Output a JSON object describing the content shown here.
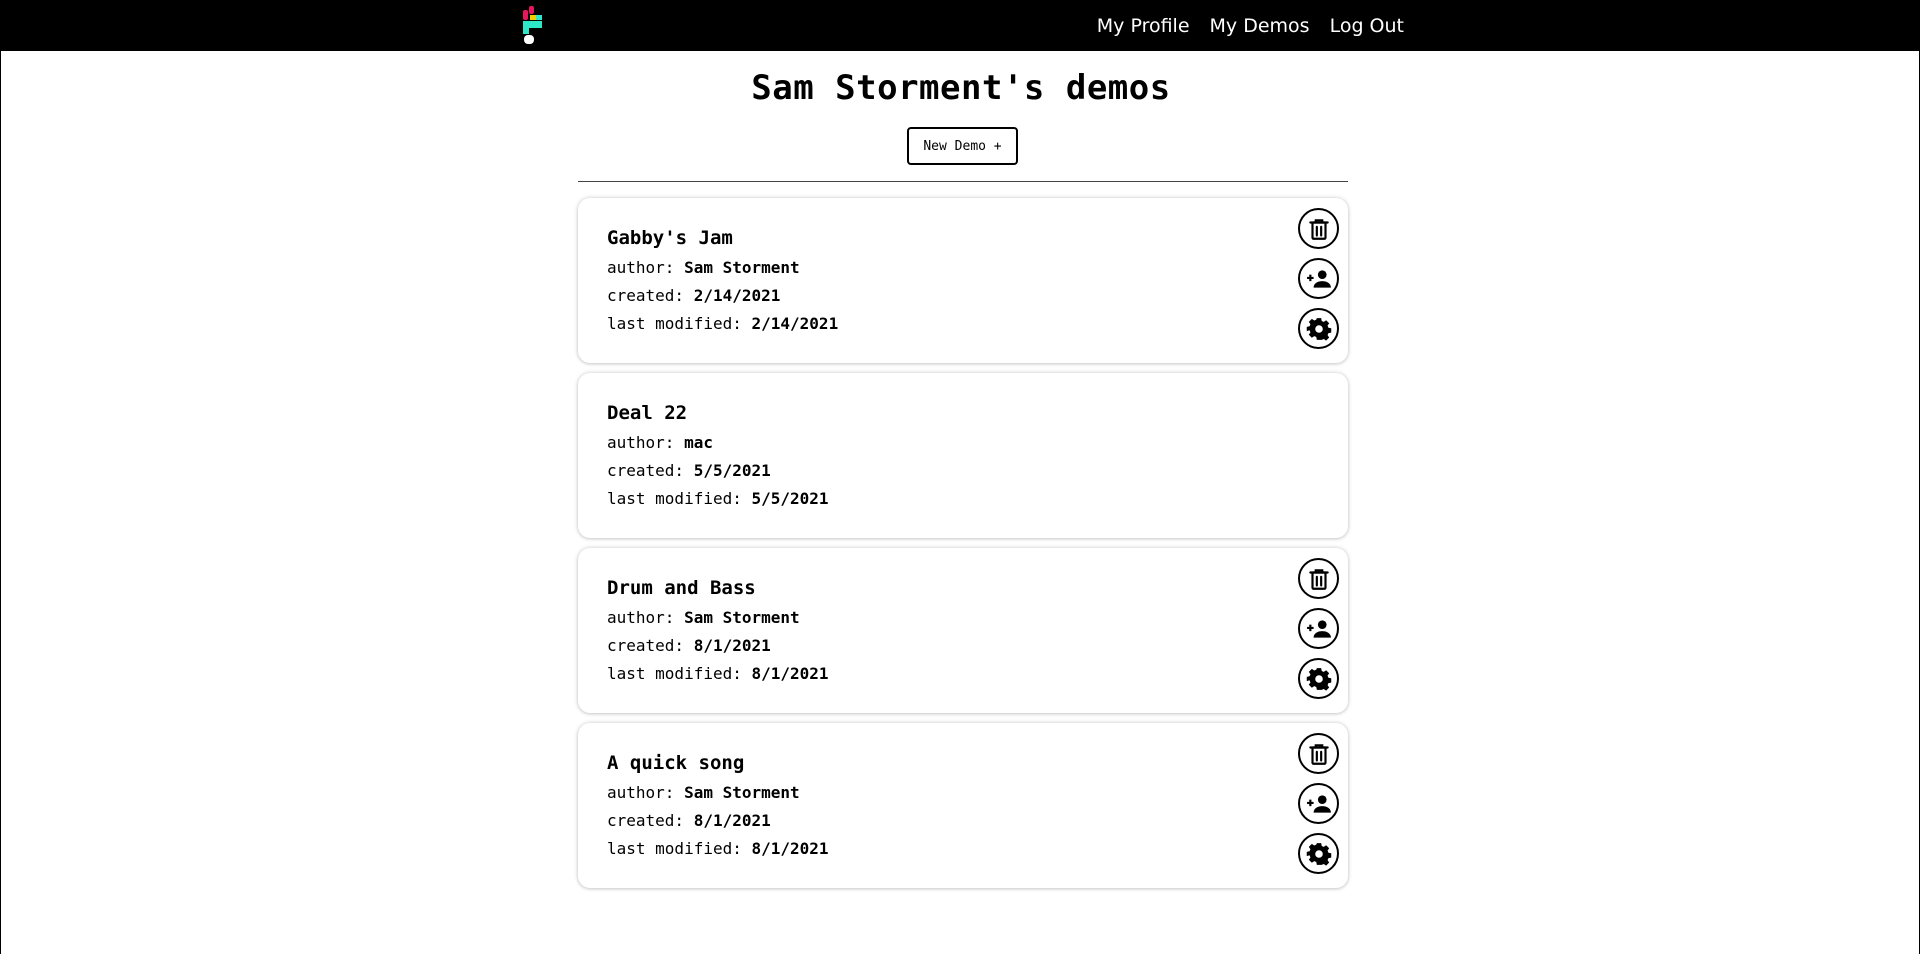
{
  "nav": {
    "logo_icon": "app-logo-icon",
    "links": [
      "My Profile",
      "My Demos",
      "Log Out"
    ]
  },
  "page": {
    "title": "Sam Storment's demos",
    "new_demo_label": "New Demo +"
  },
  "labels": {
    "author": "author:",
    "created": "created:",
    "last_modified": "last modified:"
  },
  "demos": [
    {
      "title": "Gabby's Jam",
      "author": "Sam Storment",
      "created": "2/14/2021",
      "modified": "2/14/2021",
      "actions": [
        "trash-icon",
        "add-user-icon",
        "gear-icon"
      ]
    },
    {
      "title": "Deal 22",
      "author": "mac",
      "created": "5/5/2021",
      "modified": "5/5/2021",
      "actions": []
    },
    {
      "title": "Drum and Bass",
      "author": "Sam Storment",
      "created": "8/1/2021",
      "modified": "8/1/2021",
      "actions": [
        "trash-icon",
        "add-user-icon",
        "gear-icon"
      ]
    },
    {
      "title": "A quick song",
      "author": "Sam Storment",
      "created": "8/1/2021",
      "modified": "8/1/2021",
      "actions": [
        "trash-icon",
        "add-user-icon",
        "gear-icon"
      ]
    }
  ],
  "colors": {
    "navbar": "#000000",
    "logo_pink": "#e8175d",
    "logo_yellow": "#f5d000",
    "logo_teal": "#2ee6c8"
  }
}
